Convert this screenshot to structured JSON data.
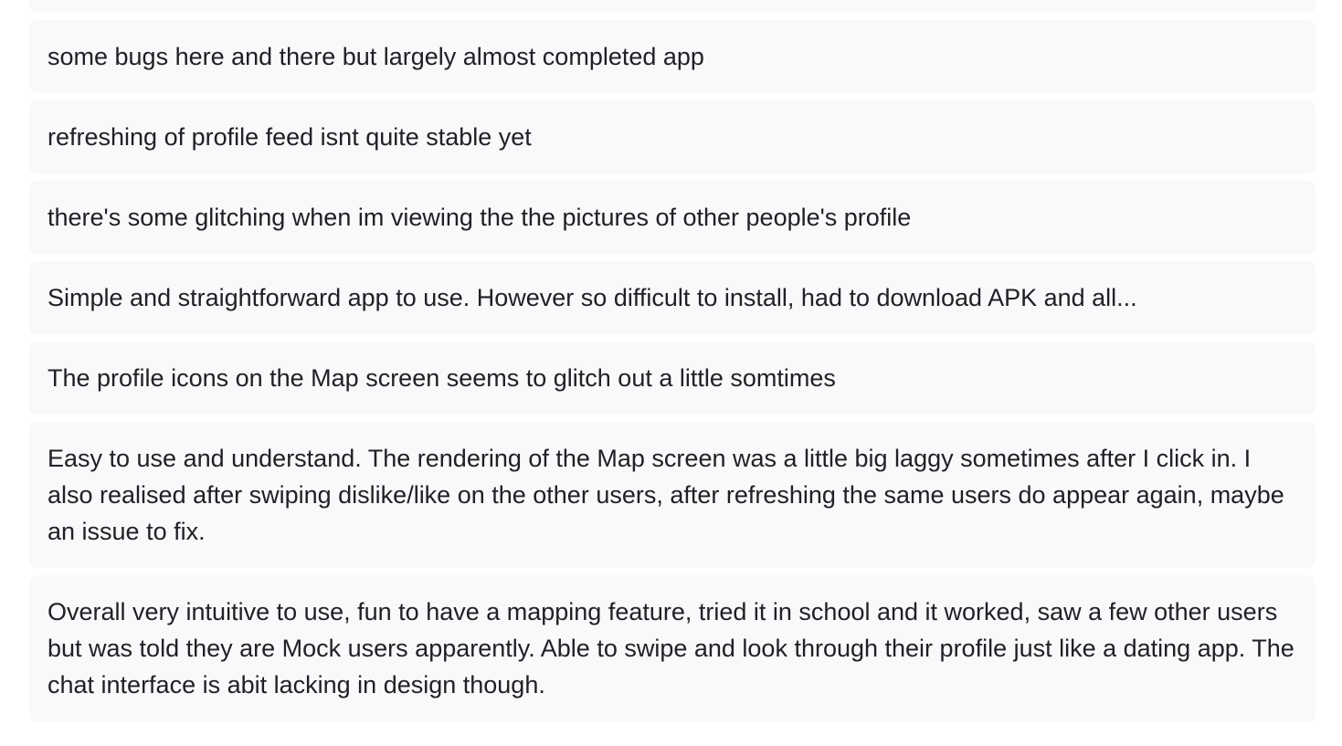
{
  "responses": {
    "items": [
      {
        "text": ""
      },
      {
        "text": "some bugs here and there but largely almost completed app"
      },
      {
        "text": "refreshing of profile feed isnt quite stable yet"
      },
      {
        "text": "there's some glitching when im viewing the the pictures of other people's profile"
      },
      {
        "text": "Simple and straightforward app to use. However so difficult to install, had to download APK and all..."
      },
      {
        "text": "The profile icons on the Map screen seems to glitch out a little somtimes"
      },
      {
        "text": "Easy to use and understand. The rendering of the Map screen was a little big laggy sometimes after I click in. I also realised after swiping dislike/like on the other users, after refreshing the same users do appear again, maybe an issue to fix."
      },
      {
        "text": "Overall very intuitive to use, fun to have a mapping feature, tried it in school and it worked, saw a few other users but was told they are Mock users apparently. Able to swipe and look through their profile just like a dating app. The chat interface is abit lacking in design though."
      }
    ]
  }
}
